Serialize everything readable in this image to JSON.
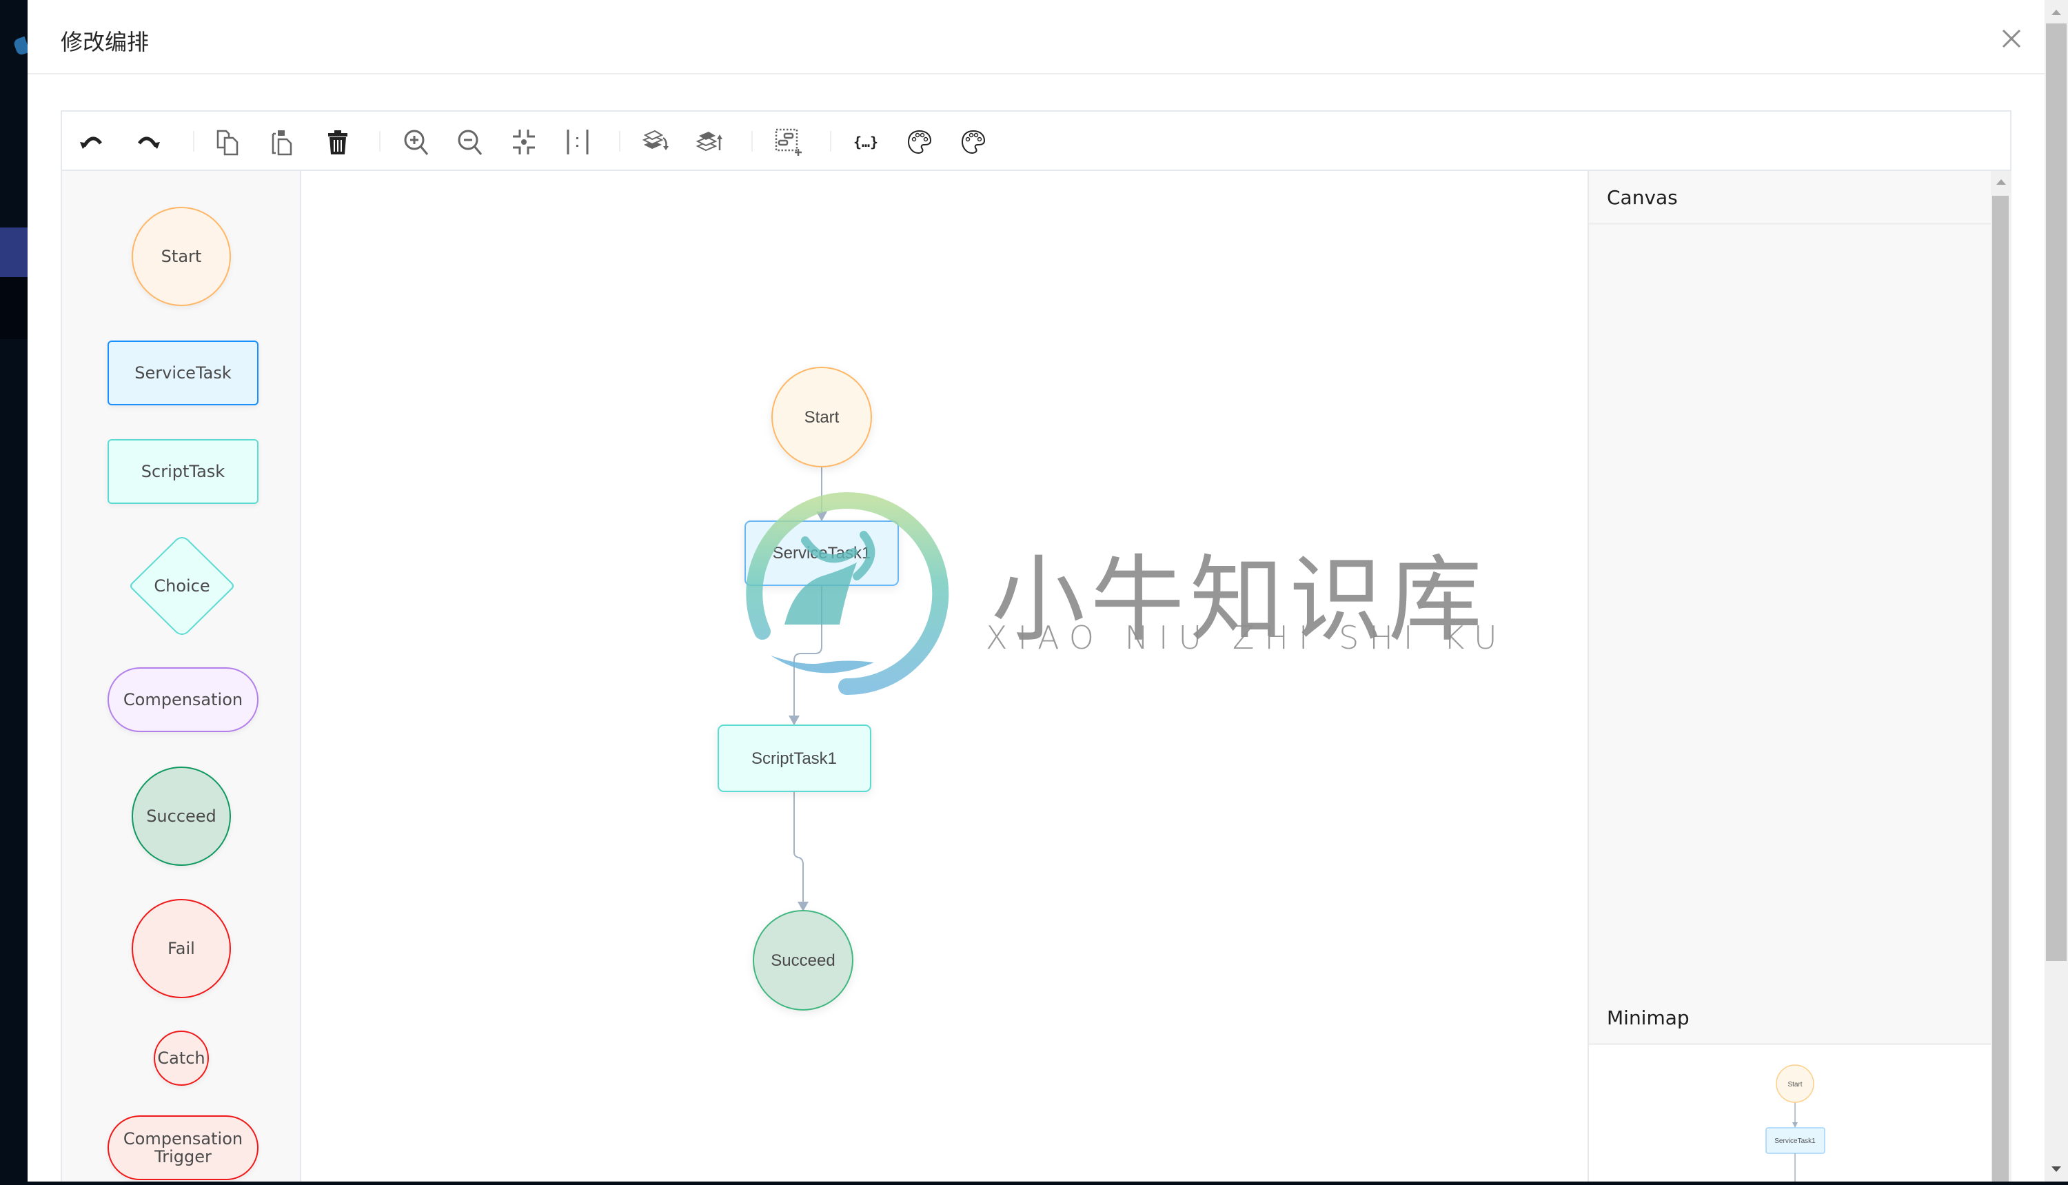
{
  "dialog": {
    "title": "修改编排",
    "close_icon": "close-icon"
  },
  "toolbar": {
    "buttons": [
      {
        "name": "undo",
        "icon": "undo-icon"
      },
      {
        "name": "redo",
        "icon": "redo-icon"
      },
      {
        "name": "copy",
        "icon": "copy-icon"
      },
      {
        "name": "paste",
        "icon": "paste-icon"
      },
      {
        "name": "delete",
        "icon": "trash-icon"
      },
      {
        "name": "zoom-in",
        "icon": "zoom-in-icon"
      },
      {
        "name": "zoom-out",
        "icon": "zoom-out-icon"
      },
      {
        "name": "fit-view",
        "icon": "fit-view-icon"
      },
      {
        "name": "actual-size",
        "icon": "actual-size-icon"
      },
      {
        "name": "to-back",
        "icon": "layer-down-icon"
      },
      {
        "name": "to-front",
        "icon": "layer-up-icon"
      },
      {
        "name": "multi-select",
        "icon": "multi-select-icon"
      },
      {
        "name": "json",
        "icon": "json-braces-icon"
      },
      {
        "name": "theme-1",
        "icon": "palette-icon"
      },
      {
        "name": "theme-2",
        "icon": "palette-icon"
      }
    ]
  },
  "palette": {
    "items": [
      {
        "label": "Start",
        "shape": "circle",
        "fill": "#fef4ea",
        "stroke": "#ffb766"
      },
      {
        "label": "ServiceTask",
        "shape": "rect",
        "fill": "#e6f6ff",
        "stroke": "#1890ff"
      },
      {
        "label": "ScriptTask",
        "shape": "rect",
        "fill": "#e6fffb",
        "stroke": "#5cdbd3"
      },
      {
        "label": "Choice",
        "shape": "diamond",
        "fill": "#e6fffb",
        "stroke": "#5cdbd3"
      },
      {
        "label": "Compensation",
        "shape": "pill",
        "fill": "#f8efff",
        "stroke": "#b37feb"
      },
      {
        "label": "Succeed",
        "shape": "circle",
        "fill": "#d2e7dc",
        "stroke": "#0f9960"
      },
      {
        "label": "Fail",
        "shape": "circle",
        "fill": "#fdebe8",
        "stroke": "#f01818"
      },
      {
        "label": "Catch",
        "shape": "small-circle",
        "fill": "#fdebe8",
        "stroke": "#f01818"
      },
      {
        "label": "Compensation\nTrigger",
        "label_lines": [
          "Compensation",
          "Trigger"
        ],
        "shape": "pill",
        "fill": "#fdebe8",
        "stroke": "#f01818"
      }
    ]
  },
  "canvas": {
    "nodes": [
      {
        "id": "start",
        "label": "Start",
        "type": "Start"
      },
      {
        "id": "servicetask1",
        "label": "ServiceTask1",
        "type": "ServiceTask"
      },
      {
        "id": "scripttask1",
        "label": "ScriptTask1",
        "type": "ScriptTask"
      },
      {
        "id": "succeed",
        "label": "Succeed",
        "type": "Succeed"
      }
    ],
    "edges": [
      {
        "from": "start",
        "to": "servicetask1"
      },
      {
        "from": "servicetask1",
        "to": "scripttask1"
      },
      {
        "from": "scripttask1",
        "to": "succeed"
      }
    ],
    "edge_color": "#a2b1c3"
  },
  "watermark": {
    "title": "小牛知识库",
    "subtitle": "XIAO NIU ZHI SHI KU"
  },
  "details_panel": {
    "canvas_title": "Canvas",
    "minimap_title": "Minimap",
    "minimap_nodes": [
      {
        "label": "Start"
      },
      {
        "label": "ServiceTask1"
      }
    ]
  }
}
